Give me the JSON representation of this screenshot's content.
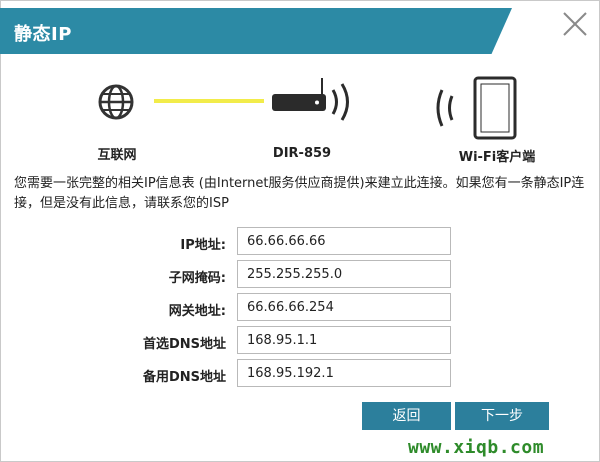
{
  "dialog": {
    "title": "静态IP",
    "close_icon": "close-icon"
  },
  "diagram": {
    "internet_label": "互联网",
    "router_label": "DIR-859",
    "client_label": "Wi-Fi客户端",
    "link_color": "#f2ec4a"
  },
  "description": "您需要一张完整的相关IP信息表 (由Internet服务供应商提供)来建立此连接。如果您有一条静态IP连接，但是没有此信息，请联系您的ISP",
  "form": {
    "ip": {
      "label": "IP地址:",
      "value": "66.66.66.66"
    },
    "subnet": {
      "label": "子网掩码:",
      "value": "255.255.255.0"
    },
    "gateway": {
      "label": "网关地址:",
      "value": "66.66.66.254"
    },
    "dns1": {
      "label": "首选DNS地址",
      "value": "168.95.1.1"
    },
    "dns2": {
      "label": "备用DNS地址",
      "value": "168.95.192.1"
    }
  },
  "buttons": {
    "back": "返回",
    "next": "下一步"
  },
  "watermark": "www.xiqb.com",
  "colors": {
    "header": "#2c8aa5",
    "button": "#2c7f9c",
    "watermark": "#2e8b2a"
  }
}
